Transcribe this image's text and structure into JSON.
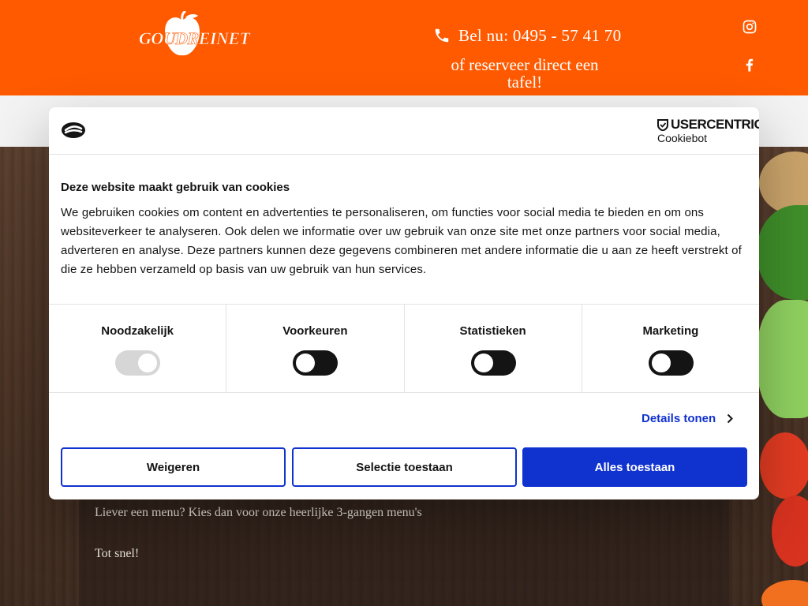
{
  "header": {
    "logo_text": "Goudreinet",
    "call_text": "Bel nu: 0495 - 57 41 70",
    "reserve_text": "of reserveer direct een tafel!",
    "icons": [
      "phone-icon",
      "instagram-icon",
      "facebook-icon"
    ],
    "brand_color": "#ff5a00"
  },
  "background_content": {
    "line1": "Liever een menu? Kies dan voor onze heerlijke 3-gangen menu's",
    "line2": "Tot snel!"
  },
  "cookie_dialog": {
    "brand_name": "USERCENTRICS",
    "brand_sub": "Cookiebot",
    "title": "Deze website maakt gebruik van cookies",
    "text": "We gebruiken cookies om content en advertenties te personaliseren, om functies voor social media te bieden en om ons websiteverkeer te analyseren. Ook delen we informatie over uw gebruik van onze site met onze partners voor social media, adverteren en analyse. Deze partners kunnen deze gegevens combineren met andere informatie die u aan ze heeft verstrekt of die ze hebben verzameld op basis van uw gebruik van hun services.",
    "categories": [
      {
        "label": "Noodzakelijk",
        "enabled": true,
        "locked": true
      },
      {
        "label": "Voorkeuren",
        "enabled": false,
        "locked": false
      },
      {
        "label": "Statistieken",
        "enabled": false,
        "locked": false
      },
      {
        "label": "Marketing",
        "enabled": false,
        "locked": false
      }
    ],
    "details_label": "Details tonen",
    "buttons": {
      "deny": "Weigeren",
      "select": "Selectie toestaan",
      "allow_all": "Alles toestaan"
    },
    "accent_color": "#1032cf"
  }
}
